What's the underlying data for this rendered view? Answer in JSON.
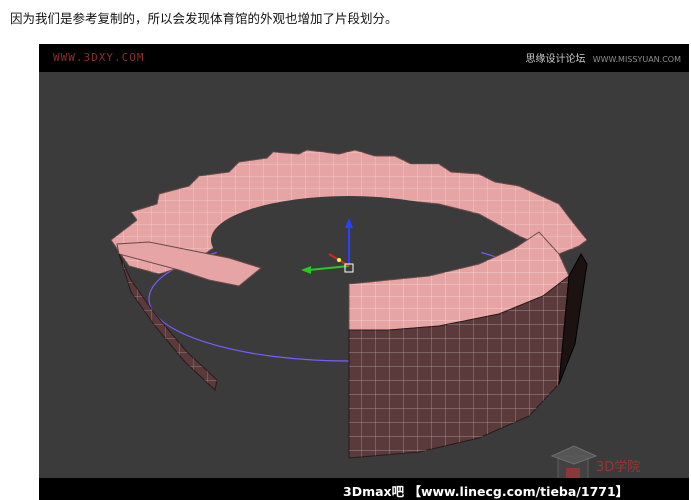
{
  "caption": "因为我们是参考复制的，所以会发现体育馆的外观也增加了片段划分。",
  "viewport": {
    "watermark": "WWW.3DXY.COM",
    "brand": "思缘设计论坛",
    "brand_sub": "WWW.MISSYUAN.COM",
    "footer_text": "3Dmax吧 【www.linecg.com/tieba/1771】",
    "logo_text": "3D学院"
  },
  "colors": {
    "viewport_bg": "#3b3b3b",
    "surface": "#e8a8a8",
    "wall": "#5a3a3a",
    "wire": "#ffffff",
    "ring": "#7a5cff"
  },
  "icons": {
    "gizmo": "transform-gizmo-icon",
    "logo": "school-cap-logo"
  }
}
